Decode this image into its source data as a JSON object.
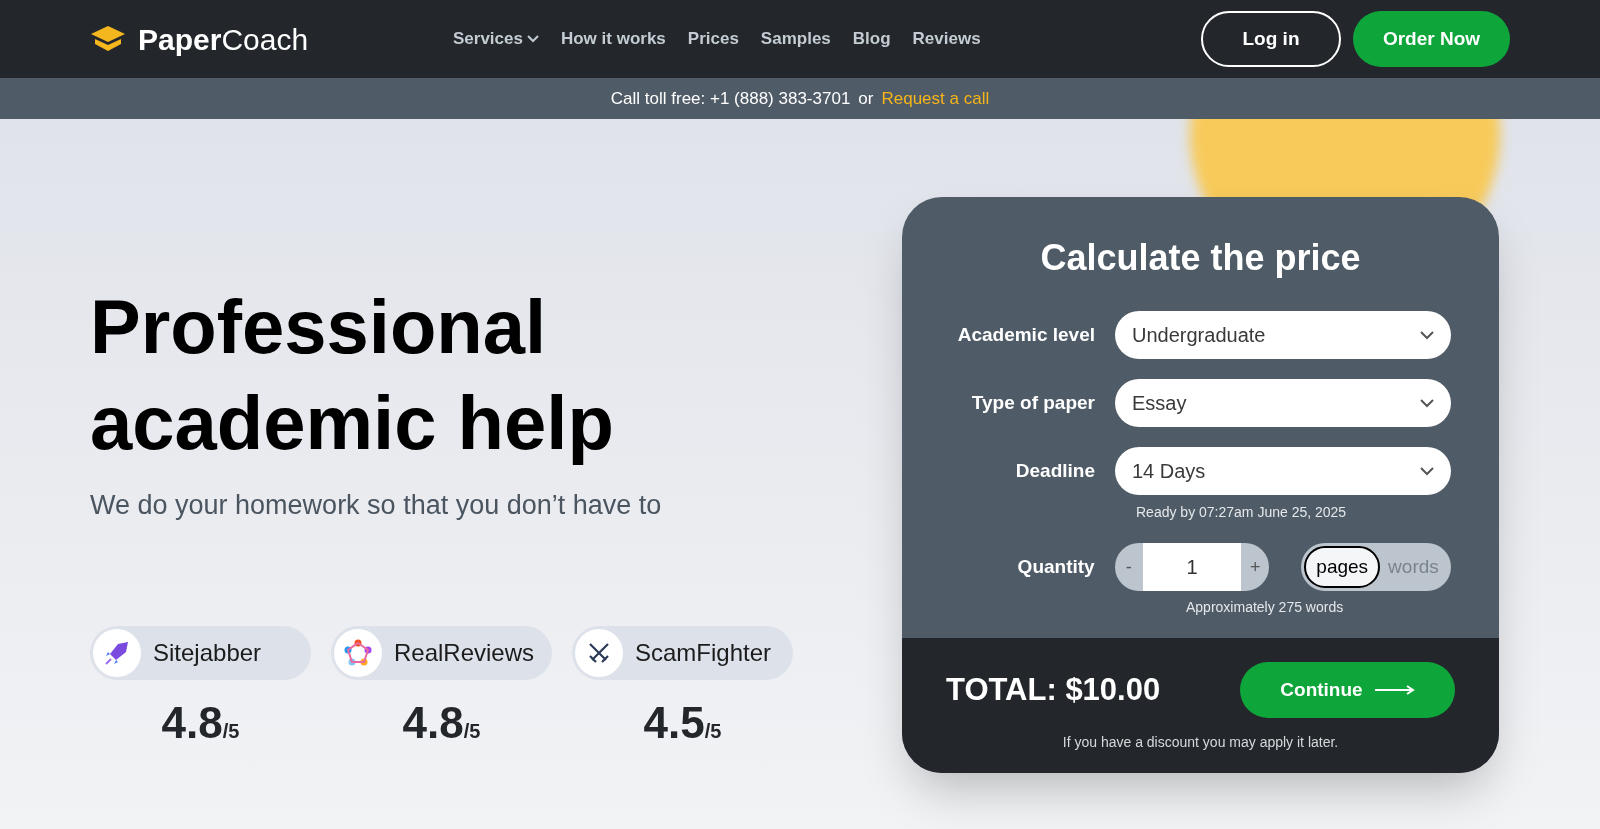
{
  "header": {
    "logo": {
      "bold": "Paper",
      "light": "Coach"
    },
    "nav": [
      {
        "label": "Services",
        "has_dropdown": true
      },
      {
        "label": "How it works",
        "has_dropdown": false
      },
      {
        "label": "Prices",
        "has_dropdown": false
      },
      {
        "label": "Samples",
        "has_dropdown": false
      },
      {
        "label": "Blog",
        "has_dropdown": false
      },
      {
        "label": "Reviews",
        "has_dropdown": false
      }
    ],
    "login": "Log in",
    "order": "Order Now"
  },
  "contact_bar": {
    "text": "Call toll free: +1 (888) 383-3701",
    "separator": "or",
    "link": "Request a call"
  },
  "hero": {
    "title_lines": [
      "Professional",
      "academic help"
    ],
    "subtitle": "We do your homework so that you don’t have to"
  },
  "ratings": [
    {
      "name": "Sitejabber",
      "kind": "rocket",
      "score": "4.8",
      "out_of": "/5"
    },
    {
      "name": "RealReviews",
      "kind": "dots",
      "score": "4.8",
      "out_of": "/5"
    },
    {
      "name": "ScamFighter",
      "kind": "swords",
      "score": "4.5",
      "out_of": "/5"
    }
  ],
  "calculator": {
    "title": "Calculate the price",
    "fields": [
      {
        "label": "Academic level",
        "value": "Undergraduate"
      },
      {
        "label": "Type of paper",
        "value": "Essay"
      },
      {
        "label": "Deadline",
        "value": "14 Days",
        "hint": "Ready by 07:27am June 25, 2025"
      }
    ],
    "quantity": {
      "label": "Quantity",
      "minus": "-",
      "value": "1",
      "plus": "+",
      "units": [
        {
          "label": "pages",
          "selected": true
        },
        {
          "label": "words",
          "selected": false
        }
      ],
      "hint": "Approximately 275 words"
    },
    "total": "TOTAL: $10.00",
    "continue": "Continue",
    "note": "If you have a discount you may apply it later."
  }
}
